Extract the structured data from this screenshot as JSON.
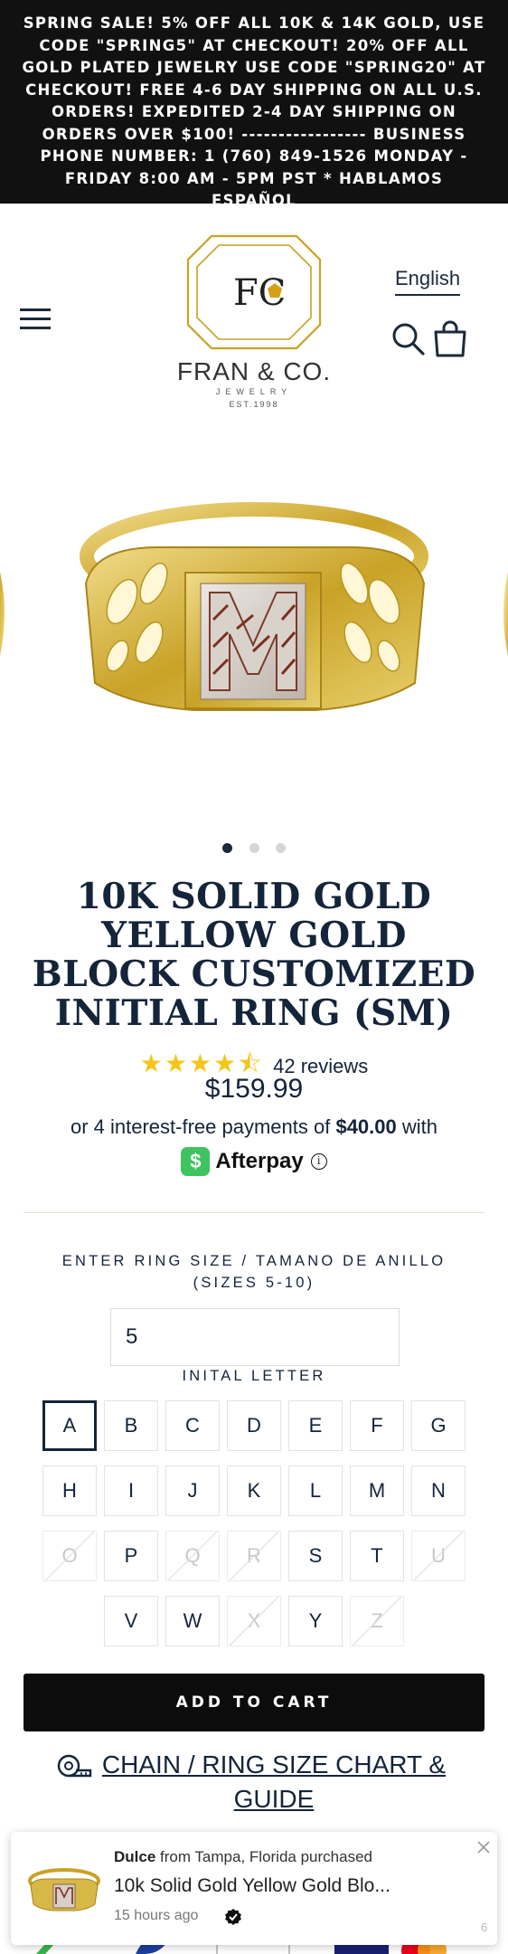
{
  "announcement": {
    "text": "Spring Sale! 5% off all 10k & 14k gold, use code \"SPRING5\" at checkout! 20% off all gold plated jewelry use code \"SPRING20\" at checkout! Free 4-6 day shipping on all U.S. orders! Expedited 2-4 day shipping on orders over $100! ----------------- Business Phone Number: 1 (760) 849-1526 Monday - Friday 8:00 AM - 5PM PST * Hablamos Español"
  },
  "header": {
    "logo_monogram": "FC",
    "logo_name": "FRAN & CO.",
    "logo_sub": "JEWELRY",
    "logo_est": "EST.1998",
    "language": "English",
    "icons": [
      "menu-icon",
      "search-icon",
      "cart-icon"
    ]
  },
  "gallery": {
    "slides": 3,
    "active_slide": 1
  },
  "product": {
    "title": "10K Solid Gold Yellow Gold Block Customized Initial Ring (SM)",
    "rating": 4.5,
    "stars": "★★★★⯪",
    "reviews": "42 reviews",
    "price": "$159.99",
    "installments_prefix": "or 4 interest-free payments of ",
    "installment_amount": "$40.00",
    "installments_suffix": " with",
    "afterpay_symbol": "$",
    "afterpay_label": "Afterpay",
    "afterpay_info": "i"
  },
  "options": {
    "size_label": "Enter Ring Size / Tamano De Anillo (Sizes 5-10)",
    "size_value": "5",
    "letter_label": "INITAL LETTER",
    "selected_letter": "A",
    "rows": [
      [
        {
          "l": "A",
          "s": "selected"
        },
        {
          "l": "B",
          "s": "available"
        },
        {
          "l": "C",
          "s": "available"
        },
        {
          "l": "D",
          "s": "available"
        },
        {
          "l": "E",
          "s": "available"
        },
        {
          "l": "F",
          "s": "available"
        },
        {
          "l": "G",
          "s": "available"
        }
      ],
      [
        {
          "l": "H",
          "s": "available"
        },
        {
          "l": "I",
          "s": "available"
        },
        {
          "l": "J",
          "s": "available"
        },
        {
          "l": "K",
          "s": "available"
        },
        {
          "l": "L",
          "s": "available"
        },
        {
          "l": "M",
          "s": "available"
        },
        {
          "l": "N",
          "s": "available"
        }
      ],
      [
        {
          "l": "O",
          "s": "disabled"
        },
        {
          "l": "P",
          "s": "available"
        },
        {
          "l": "Q",
          "s": "disabled"
        },
        {
          "l": "R",
          "s": "disabled"
        },
        {
          "l": "S",
          "s": "available"
        },
        {
          "l": "T",
          "s": "available"
        },
        {
          "l": "U",
          "s": "disabled"
        }
      ],
      [
        {
          "l": "V",
          "s": "available"
        },
        {
          "l": "W",
          "s": "available"
        },
        {
          "l": "X",
          "s": "disabled"
        },
        {
          "l": "Y",
          "s": "available"
        },
        {
          "l": "Z",
          "s": "disabled"
        }
      ]
    ]
  },
  "actions": {
    "add_to_cart": "ADD TO CART",
    "size_chart": "Chain / Ring Size Chart & Guide"
  },
  "popup": {
    "buyer": "Dulce",
    "location": " from Tampa, Florida purchased",
    "product": "10k Solid Gold Yellow Gold Blo...",
    "time": "15 hours ago",
    "counter": "6"
  },
  "colors": {
    "accent": "#14243a",
    "announcement_bg": "#111111",
    "star": "#f5c518",
    "afterpay": "#3ec35f",
    "gold": "#c9a227"
  }
}
